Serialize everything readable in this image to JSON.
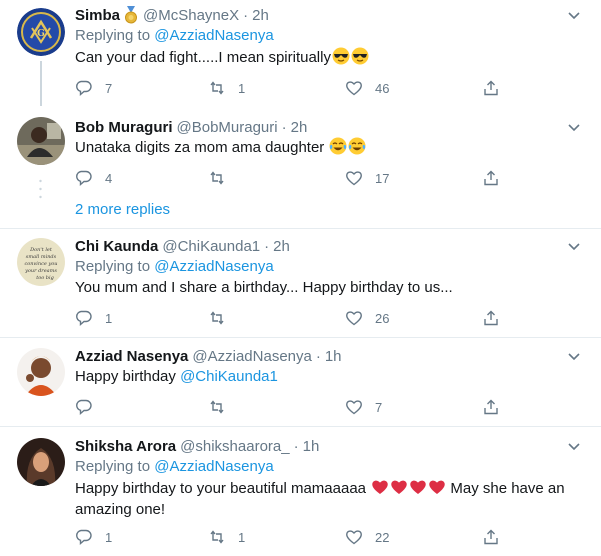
{
  "tweets": [
    {
      "name": "Simba",
      "handle": "@McShayneX",
      "time": "2h",
      "replying_prefix": "Replying to ",
      "replying_to": "@AzziadNasenya",
      "text": "Can your dad fight.....I mean spiritually",
      "emoji": "sunglasses-emoji x2",
      "replies": "7",
      "retweets": "1",
      "likes": "46"
    },
    {
      "name": "Bob Muraguri",
      "handle": "@BobMuraguri",
      "time": "2h",
      "text": "Unataka digits za mom ama daughter",
      "emoji": "tears-of-joy-emoji x2",
      "replies": "4",
      "retweets": "",
      "likes": "17"
    },
    {
      "name": "Chi Kaunda",
      "handle": "@ChiKaunda1",
      "time": "2h",
      "replying_prefix": "Replying to ",
      "replying_to": "@AzziadNasenya",
      "text": "You mum and I share a birthday... Happy birthday to us...",
      "replies": "1",
      "retweets": "",
      "likes": "26"
    },
    {
      "name": "Azziad Nasenya",
      "handle": "@AzziadNasenya",
      "time": "1h",
      "text_prefix": "Happy birthday ",
      "text_mention": "@ChiKaunda1",
      "replies": "",
      "retweets": "",
      "likes": "7"
    },
    {
      "name": "Shiksha Arora",
      "handle": "@shikshaarora_",
      "time": "1h",
      "replying_prefix": "Replying to ",
      "replying_to": "@AzziadNasenya",
      "text_before": "Happy birthday to your beautiful mamaaaaa ",
      "emoji": "red-heart-emoji x4",
      "text_after": " May she have an amazing one!",
      "replies": "1",
      "retweets": "1",
      "likes": "22"
    }
  ],
  "more_replies": "2 more replies",
  "separator": "·",
  "colors": {
    "accent": "#1b95e0",
    "muted": "#657786",
    "divider": "#e6ecf0",
    "text": "#14171a"
  }
}
